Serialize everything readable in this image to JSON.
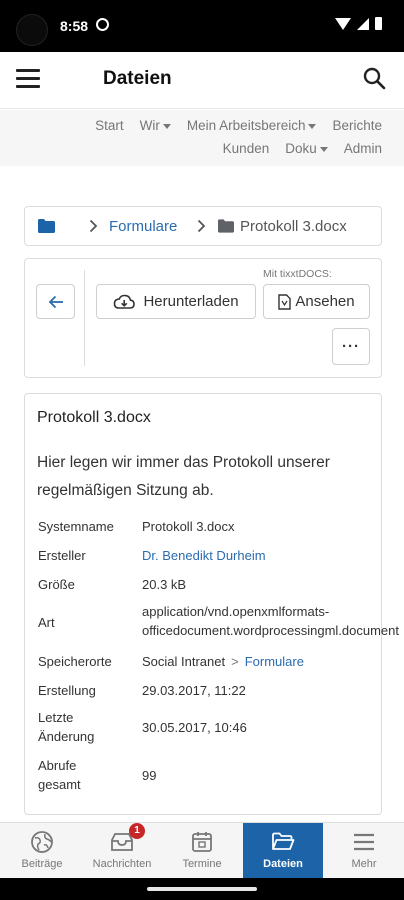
{
  "status": {
    "time": "8:58"
  },
  "appbar": {
    "title": "Dateien"
  },
  "topnav": {
    "row1": [
      "Start",
      "Wir",
      "Mein Arbeitsbereich",
      "Berichte"
    ],
    "row2": [
      "Kunden",
      "Doku",
      "Admin"
    ]
  },
  "breadcrumb": {
    "folder": "Formulare",
    "file": "Protokoll 3.docx"
  },
  "actions": {
    "tixxt_label": "Mit tixxtDOCS:",
    "download_label": "Herunterladen",
    "view_label": "Ansehen",
    "more_label": "···"
  },
  "document": {
    "title": "Protokoll 3.docx",
    "description": "Hier legen wir immer das Protokoll unserer regelmäßigen Sitzung ab.",
    "meta": {
      "systemname": {
        "key": "Systemname",
        "value": "Protokoll 3.docx"
      },
      "ersteller": {
        "key": "Ersteller",
        "value": "Dr. Benedikt Durheim"
      },
      "groesse": {
        "key": "Größe",
        "value": "20.3 kB"
      },
      "art": {
        "key": "Art",
        "value_line1": "application/vnd.openxmlformats-",
        "value_line2": "officedocument.wordprocessingml.document"
      },
      "speicherorte": {
        "key": "Speicherorte",
        "value_root": "Social Intranet",
        "value_folder": "Formulare"
      },
      "erstellung": {
        "key": "Erstellung",
        "value": "29.03.2017, 11:22"
      },
      "letzte_aenderung": {
        "key_line1": "Letzte",
        "key_line2": "Änderung",
        "value": "30.05.2017, 10:46"
      },
      "abrufe": {
        "key_line1": "Abrufe",
        "key_line2": "gesamt",
        "value": "99"
      }
    }
  },
  "bottomnav": {
    "tabs": [
      {
        "label": "Beiträge"
      },
      {
        "label": "Nachrichten",
        "badge": "1"
      },
      {
        "label": "Termine"
      },
      {
        "label": "Dateien"
      },
      {
        "label": "Mehr"
      }
    ],
    "active_color": "#1d63a8"
  },
  "colors": {
    "link": "#2b6cb0",
    "badge": "#c62828"
  }
}
